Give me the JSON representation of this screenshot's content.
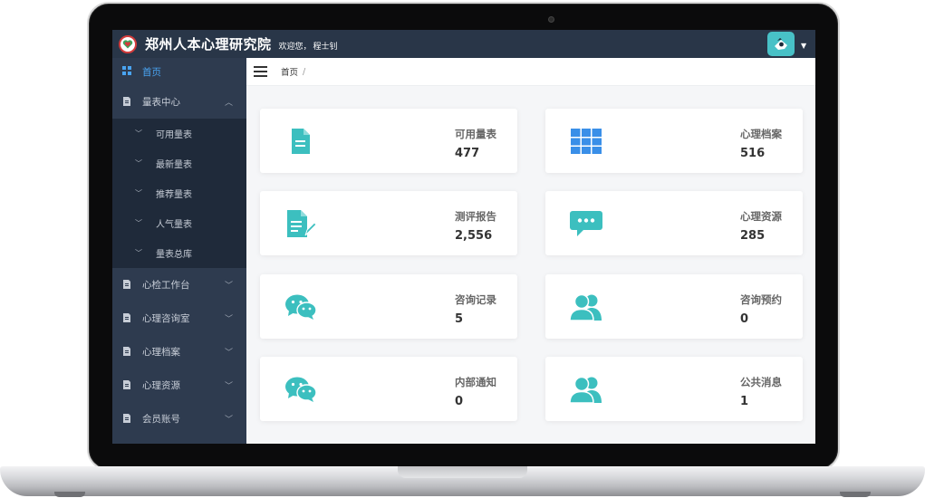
{
  "header": {
    "title": "郑州人本心理研究院",
    "welcome": "欢迎您，",
    "user_name": "程士钊"
  },
  "colors": {
    "topbar": "#293648",
    "sidebar": "#2e3b4f",
    "submenu": "#1f2a3a",
    "accent_teal": "#3cbfbf",
    "accent_blue": "#3a8fe8"
  },
  "sidebar": {
    "home": {
      "label": "首页",
      "icon": "grid-icon"
    },
    "scale_center": {
      "label": "量表中心",
      "icon": "document-icon",
      "children": [
        {
          "label": "可用量表"
        },
        {
          "label": "最新量表"
        },
        {
          "label": "推荐量表"
        },
        {
          "label": "人气量表"
        },
        {
          "label": "量表总库"
        }
      ]
    },
    "items": [
      {
        "label": "心检工作台",
        "icon": "document-icon"
      },
      {
        "label": "心理咨询室",
        "icon": "document-icon"
      },
      {
        "label": "心理档案",
        "icon": "document-icon"
      },
      {
        "label": "心理资源",
        "icon": "document-icon"
      },
      {
        "label": "会员账号",
        "icon": "document-icon"
      }
    ]
  },
  "breadcrumb": {
    "current": "首页",
    "separator": "/"
  },
  "cards": [
    {
      "label": "可用量表",
      "value": "477",
      "icon": "file-icon"
    },
    {
      "label": "心理档案",
      "value": "516",
      "icon": "table-icon"
    },
    {
      "label": "测评报告",
      "value": "2,556",
      "icon": "file-edit-icon"
    },
    {
      "label": "心理资源",
      "value": "285",
      "icon": "comment-dots-icon"
    },
    {
      "label": "咨询记录",
      "value": "5",
      "icon": "wechat-icon"
    },
    {
      "label": "咨询预约",
      "value": "0",
      "icon": "users-icon"
    },
    {
      "label": "内部通知",
      "value": "0",
      "icon": "wechat-icon"
    },
    {
      "label": "公共消息",
      "value": "1",
      "icon": "users-icon"
    }
  ]
}
